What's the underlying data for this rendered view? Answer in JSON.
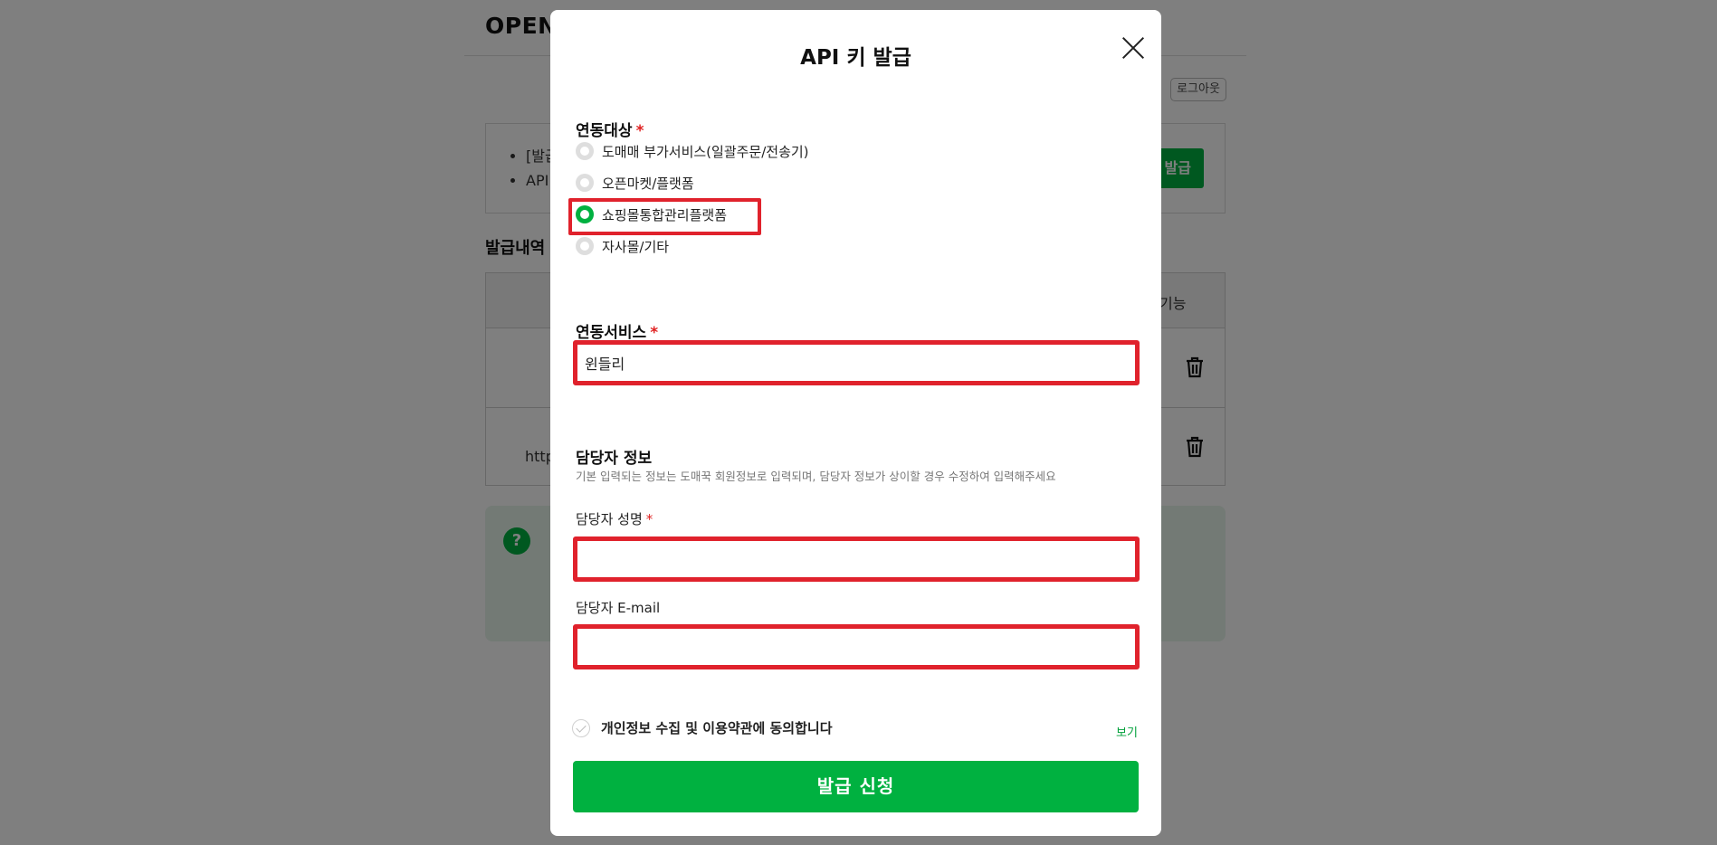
{
  "background": {
    "title": "OPEN",
    "logout_label": "로그아웃",
    "notice_items": [
      "[발급",
      "API"
    ],
    "issue_button_label": "발급",
    "history_title": "발급내역",
    "table_header_function": "기능",
    "row_url_prefix": "http",
    "help_icon_glyph": "?"
  },
  "modal": {
    "title": "API 키 발급",
    "integration_target": {
      "label": "연동대상",
      "required_mark": "*",
      "options": [
        {
          "label": "도매매 부가서비스(일괄주문/전송기)",
          "checked": false
        },
        {
          "label": "오픈마켓/플랫폼",
          "checked": false
        },
        {
          "label": "쇼핑몰통합관리플랫폼",
          "checked": true
        },
        {
          "label": "자사몰/기타",
          "checked": false
        }
      ]
    },
    "integration_service": {
      "label": "연동서비스",
      "required_mark": "*",
      "value": "윈들리"
    },
    "manager": {
      "section_title": "담당자 정보",
      "help_text": "기본 입력되는 정보는 도매꾹 회원정보로 입력되며, 담당자 정보가 상이할 경우 수정하여 입력해주세요",
      "name_label": "담당자 성명",
      "name_required_mark": "*",
      "name_value": "",
      "email_label": "담당자 E-mail",
      "email_value": ""
    },
    "agreement": {
      "label": "개인정보 수집 및 이용약관에 동의합니다",
      "view_link": "보기"
    },
    "submit_label": "발급 신청"
  }
}
